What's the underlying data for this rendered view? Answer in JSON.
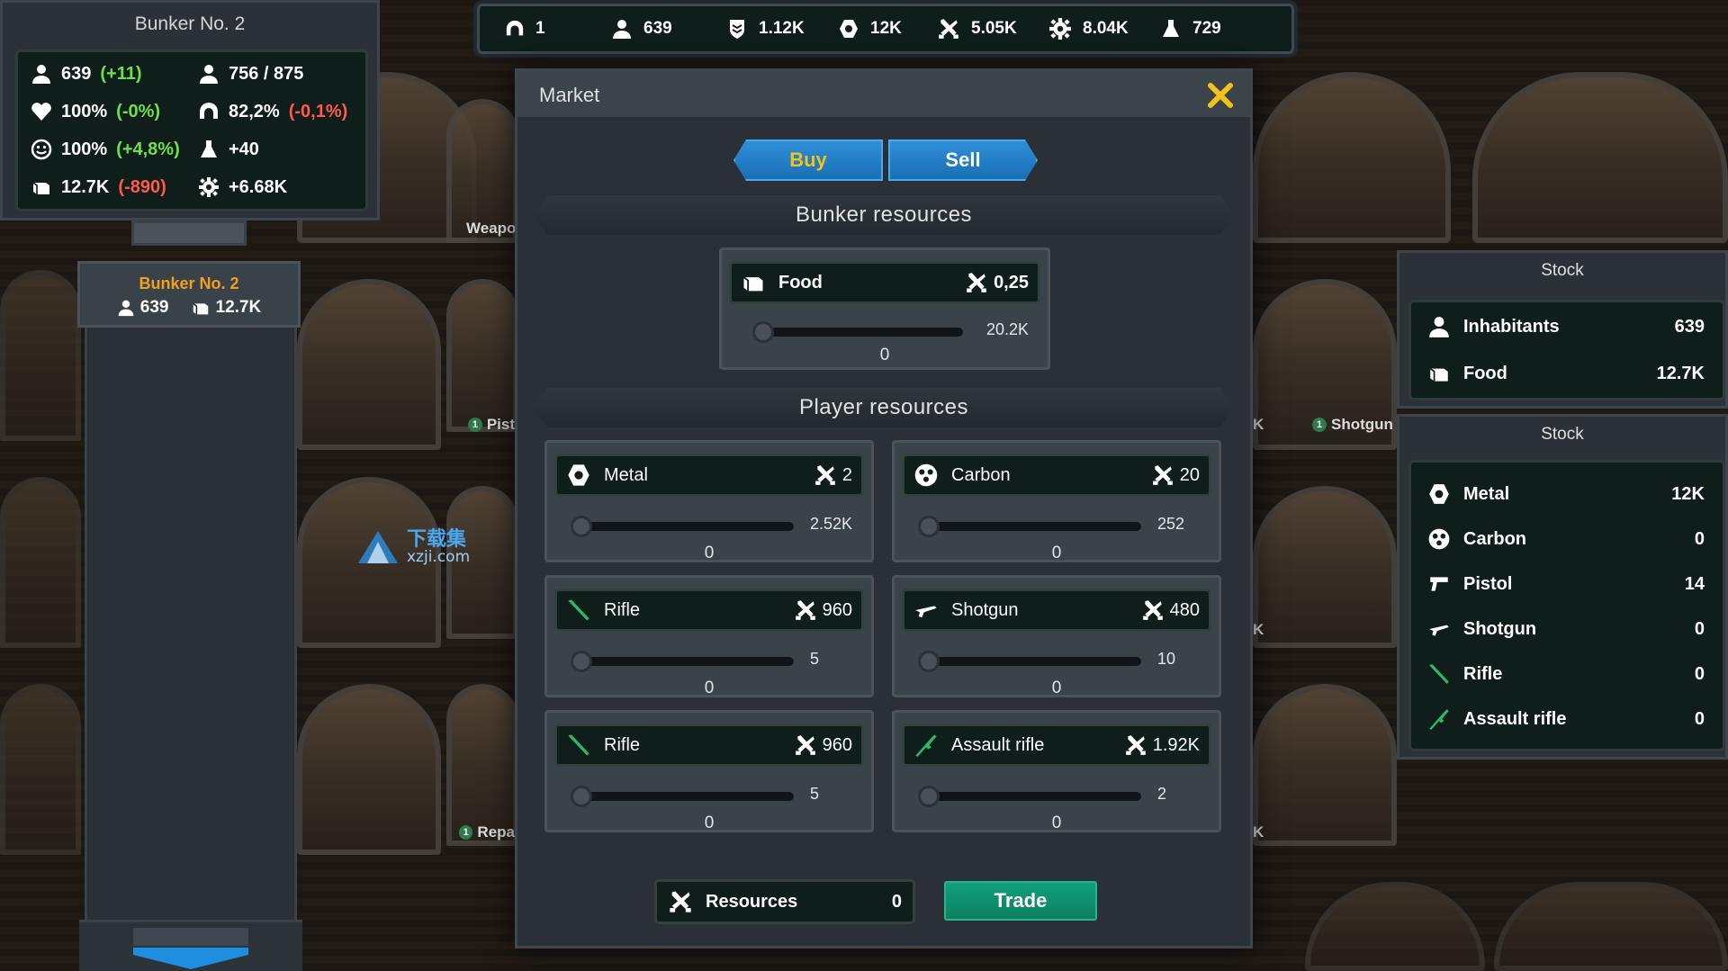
{
  "topbar": {
    "bunkers": "1",
    "inhabitants": "639",
    "defense": "1.12K",
    "metal": "12K",
    "resources": "5.05K",
    "parts": "8.04K",
    "science": "729"
  },
  "bunker_panel": {
    "title": "Bunker No. 2",
    "population": "639",
    "population_delta": "(+11)",
    "capacity": "756 / 875",
    "health": "100%",
    "health_delta": "(-0%)",
    "shelter": "82,2%",
    "shelter_delta": "(-0,1%)",
    "happiness": "100%",
    "happiness_delta": "(+4,8%)",
    "science_rate": "+40",
    "food": "12.7K",
    "food_delta": "(-890)",
    "parts_rate": "+6.68K"
  },
  "bunker_card": {
    "name": "Bunker No. 2",
    "population": "639",
    "food": "12.7K"
  },
  "scene_labels": {
    "weapons": "Weapo",
    "pistol": "Pist",
    "shotgun": "Shotgun",
    "repair": "Repa",
    "k1": "K",
    "k2": "K",
    "k3": "K"
  },
  "watermark": {
    "cn": "下载集",
    "url": "xzji.com"
  },
  "market": {
    "title": "Market",
    "tabs": {
      "buy": "Buy",
      "sell": "Sell"
    },
    "bunker_section": "Bunker resources",
    "player_section": "Player resources",
    "bunker_items": [
      {
        "name": "Food",
        "price": "0,25",
        "max": "20.2K",
        "value": "0",
        "icon": "food-icon"
      }
    ],
    "player_items": [
      {
        "name": "Metal",
        "price": "2",
        "max": "2.52K",
        "value": "0",
        "icon": "metal-icon"
      },
      {
        "name": "Carbon",
        "price": "20",
        "max": "252",
        "value": "0",
        "icon": "carbon-icon"
      },
      {
        "name": "Rifle",
        "price": "960",
        "max": "5",
        "value": "0",
        "icon": "rifle-icon"
      },
      {
        "name": "Shotgun",
        "price": "480",
        "max": "10",
        "value": "0",
        "icon": "shotgun-icon"
      },
      {
        "name": "Rifle",
        "price": "960",
        "max": "5",
        "value": "0",
        "icon": "rifle-icon"
      },
      {
        "name": "Assault rifle",
        "price": "1.92K",
        "max": "2",
        "value": "0",
        "icon": "assault-rifle-icon"
      }
    ],
    "resources_label": "Resources",
    "resources_value": "0",
    "trade_label": "Trade"
  },
  "stock_bunker": {
    "title": "Stock",
    "items": [
      {
        "label": "Inhabitants",
        "value": "639",
        "icon": "person-icon"
      },
      {
        "label": "Food",
        "value": "12.7K",
        "icon": "food-icon"
      }
    ]
  },
  "stock_player": {
    "title": "Stock",
    "items": [
      {
        "label": "Metal",
        "value": "12K",
        "icon": "metal-icon"
      },
      {
        "label": "Carbon",
        "value": "0",
        "icon": "carbon-icon"
      },
      {
        "label": "Pistol",
        "value": "14",
        "icon": "pistol-icon"
      },
      {
        "label": "Shotgun",
        "value": "0",
        "icon": "shotgun-icon"
      },
      {
        "label": "Rifle",
        "value": "0",
        "icon": "rifle-icon"
      },
      {
        "label": "Assault rifle",
        "value": "0",
        "icon": "assault-rifle-icon"
      }
    ]
  },
  "colors": {
    "accent_blue": "#1f7fc9",
    "trade_green": "#0f8f6b",
    "close_yellow": "#f3c21a",
    "positive": "#6ee04a",
    "negative": "#ff5a4a",
    "card_name": "#f0a020"
  }
}
